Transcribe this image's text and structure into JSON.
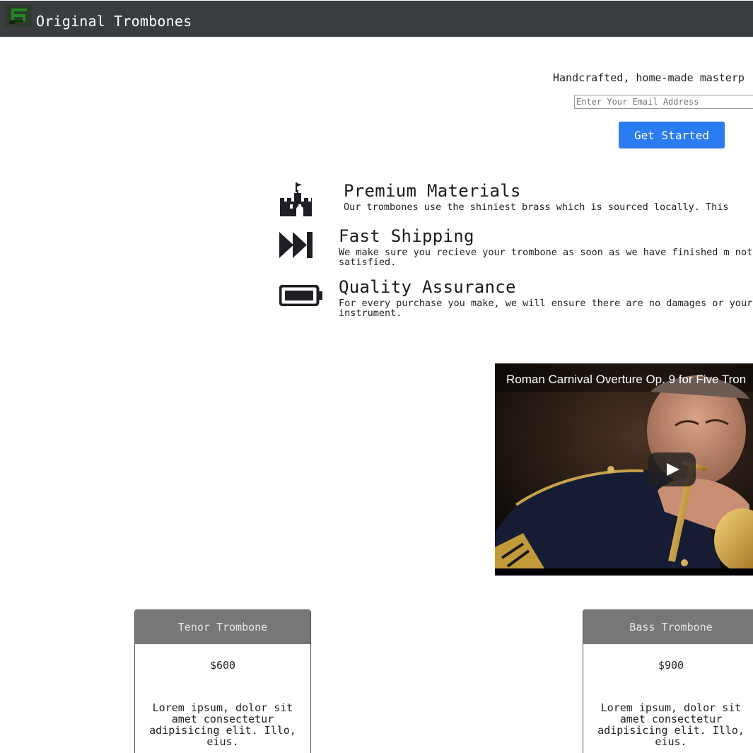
{
  "header": {
    "brand": "Original Trombones",
    "logo_icon": "trombone-logo-icon"
  },
  "hero": {
    "tagline": "Handcrafted, home-made masterp",
    "email_placeholder": "Enter Your Email Address",
    "cta_label": "Get Started",
    "cta_color": "#2b7bf2"
  },
  "features": [
    {
      "icon": "castle-icon",
      "title": "Premium Materials",
      "description": "Our trombones use the shiniest brass which is sourced locally. This"
    },
    {
      "icon": "fast-forward-icon",
      "title": "Fast Shipping",
      "description": "We make sure you recieve your trombone as soon as we have finished m not satisfied."
    },
    {
      "icon": "battery-icon",
      "title": "Quality Assurance",
      "description": "For every purchase you make, we will ensure there are no damages or your instrument."
    }
  ],
  "video": {
    "title": "Roman Carnival Overture Op. 9 for Five Tron",
    "play_icon": "play-icon"
  },
  "pricing": [
    {
      "name": "Tenor Trombone",
      "price": "$600",
      "description": "Lorem ipsum, dolor sit amet consectetur adipisicing elit. Illo, eius."
    },
    {
      "name": "Bass Trombone",
      "price": "$900",
      "description": "Lorem ipsum, dolor sit amet consectetur adipisicing elit. Illo, eius."
    }
  ]
}
